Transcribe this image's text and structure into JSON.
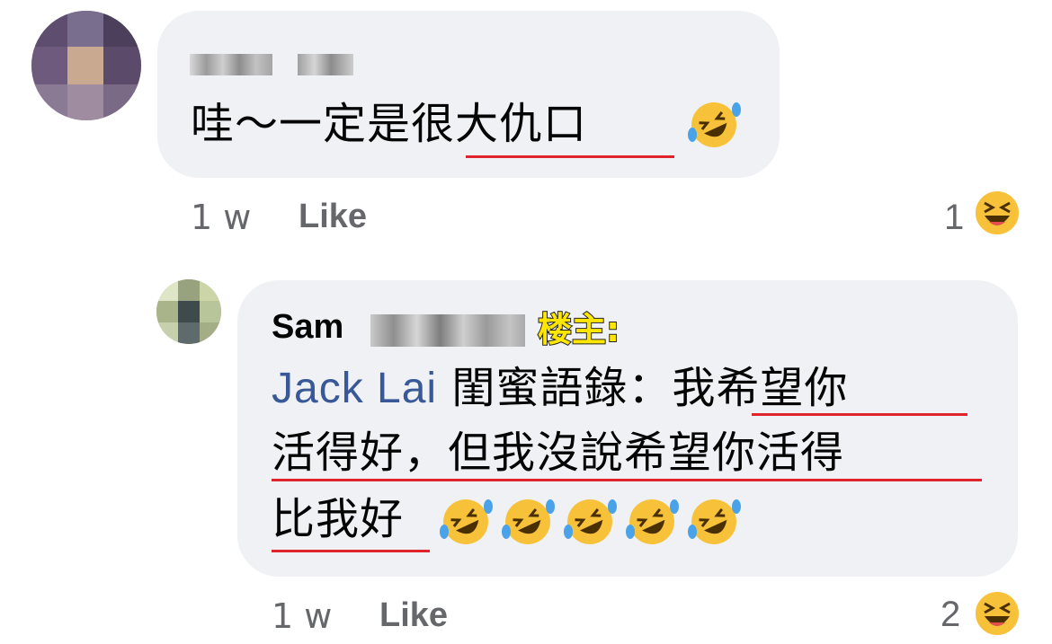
{
  "comment1": {
    "text_prefix": "哇～一定是",
    "text_underlined": "很大仇口",
    "time": "1 w",
    "like_label": "Like",
    "reaction_count": "1",
    "reaction_icon": "laughing-face-icon"
  },
  "comment2": {
    "author_first": "Sam",
    "op_tag": "楼主:",
    "mention": "Jack Lai",
    "line1_text": " 閨蜜語錄：",
    "line1_underlined": "我希望你",
    "line2_text": "活得好，但我沒說希望你活得",
    "line3_text": "比我好",
    "time": "1 w",
    "like_label": "Like",
    "reaction_count": "2",
    "reaction_icon": "laughing-face-icon"
  },
  "colors": {
    "bubble_bg": "#eff1f4",
    "underline": "#e0242b",
    "mention": "#385898",
    "meta_text": "#65676b",
    "op_tag_fill": "#ffe600"
  }
}
